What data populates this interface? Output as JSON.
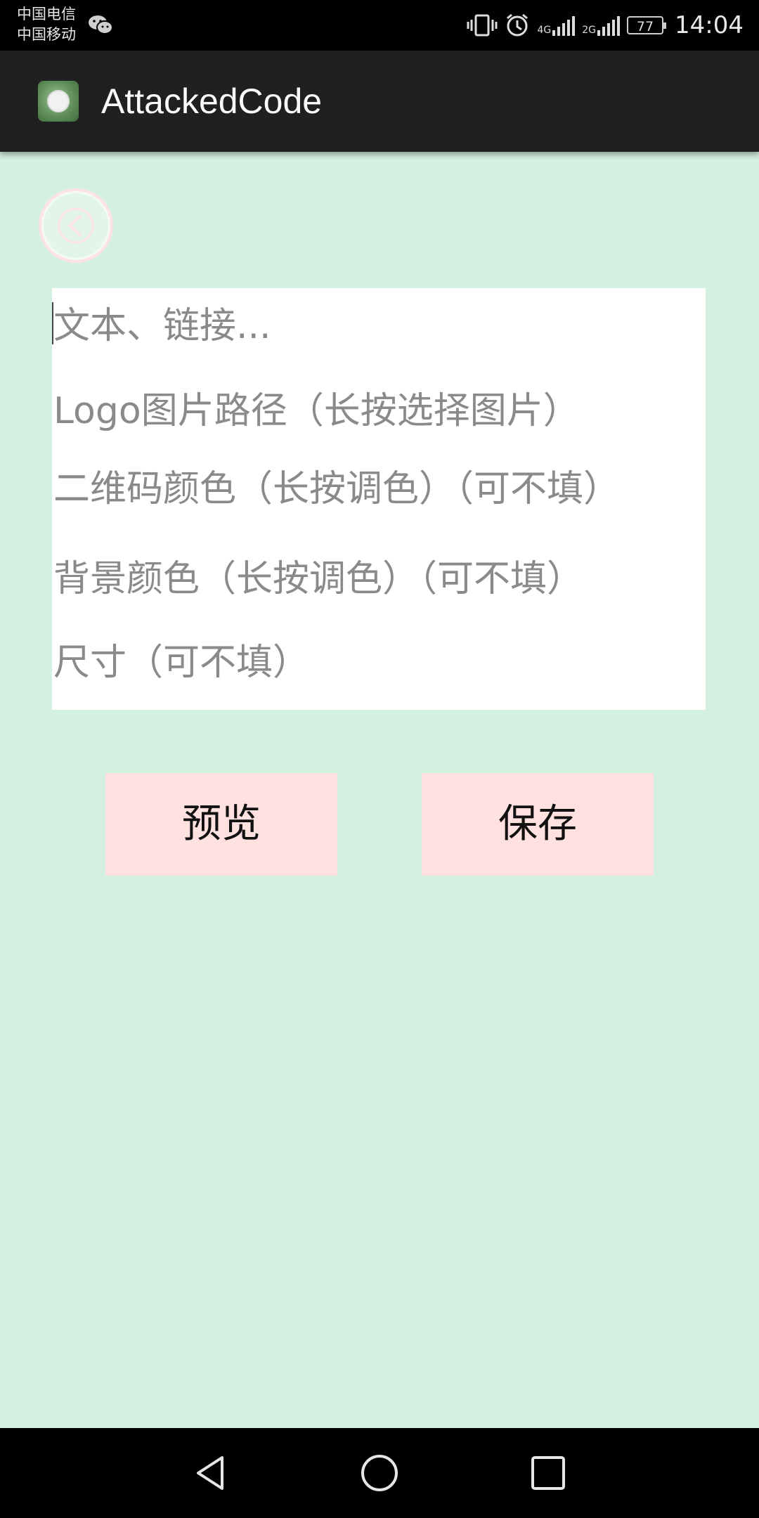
{
  "status_bar": {
    "carrier_1": "中国电信",
    "carrier_2": "中国移动",
    "net_1": "4G",
    "net_2": "2G",
    "battery": "77",
    "time": "14:04",
    "icons": [
      "wechat-icon",
      "vibrate-icon",
      "alarm-icon",
      "signal-icon",
      "battery-icon"
    ]
  },
  "app_bar": {
    "title": "AttackedCode",
    "icon": "app-logo-icon"
  },
  "back_button": {
    "icon": "chevron-left-icon"
  },
  "form": {
    "text_placeholder": "文本、链接...",
    "logo_placeholder": "Logo图片路径（长按选择图片）",
    "qr_color_placeholder": "二维码颜色（长按调色）（可不填）",
    "bg_color_placeholder": "背景颜色（长按调色）（可不填）",
    "size_placeholder": "尺寸（可不填）"
  },
  "buttons": {
    "preview_label": "预览",
    "save_label": "保存"
  },
  "nav_bar": {
    "icons": [
      "back-triangle-icon",
      "home-circle-icon",
      "recents-square-icon"
    ]
  },
  "colors": {
    "background": "#d4f0e1",
    "app_bar": "#202020",
    "button": "#ffe1df",
    "placeholder_text": "#8a8a8a"
  }
}
